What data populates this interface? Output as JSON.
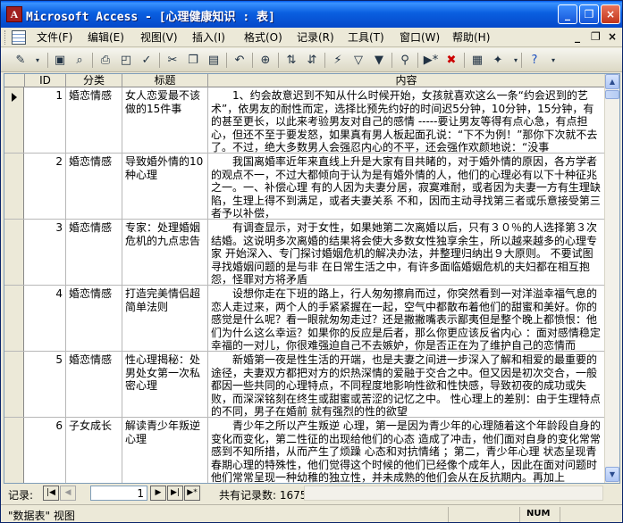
{
  "window": {
    "title": "Microsoft Access - [心理健康知识 : 表]",
    "minimize": "_",
    "restore": "❐",
    "close": "×"
  },
  "menu": {
    "items": [
      "文件(F)",
      "编辑(E)",
      "视图(V)",
      "插入(I)",
      "格式(O)",
      "记录(R)",
      "工具(T)",
      "窗口(W)",
      "帮助(H)"
    ],
    "doc_minimize": "_",
    "doc_restore": "❐",
    "doc_close": "×"
  },
  "toolbar": {
    "icons": [
      "design-view-icon",
      "save-icon",
      "search-database-icon",
      "print-icon",
      "print-preview-icon",
      "spelling-icon",
      "cut-icon",
      "copy-icon",
      "paste-icon",
      "undo-icon",
      "hyperlink-icon",
      "sort-ascending-icon",
      "sort-descending-icon",
      "filter-by-selection-icon",
      "filter-by-form-icon",
      "apply-filter-icon",
      "find-icon",
      "new-record-icon",
      "delete-record-icon",
      "database-window-icon",
      "new-object-icon",
      "help-icon"
    ]
  },
  "table": {
    "columns": [
      "ID",
      "分类",
      "标题",
      "内容"
    ],
    "rows": [
      {
        "id": "1",
        "category": "婚恋情感",
        "title": "女人恋爱最不该做的15件事",
        "content": "1、约会故意迟到不知从什么时候开始，女孩就喜欢这么一条“约会迟到的艺术”，依男友的耐性而定，选择比预先约好的时间迟5分钟，10分钟，15分钟，有的甚至更长，以此来考验男友对自己的感情 -----要让男友等得有点心急，有点担心，但还不至于要发怒，如果真有男人板起面孔说：“下不为例！”那你下次就不去了。不过，绝大多数男人会强忍内心的不平，还会强作欢颜地说：“没事"
      },
      {
        "id": "2",
        "category": "婚恋情感",
        "title": "导致婚外情的10种心理",
        "content": "我国离婚率近年来直线上升是大家有目共睹的，对于婚外情的原因，各方学者的观点不一，不过大都倾向于认为是有婚外情的人，他们的心理必有以下十种征兆之一。一、补偿心理 有的人因为夫妻分居，寂寞难耐，或者因为夫妻一方有生理缺陷，生理上得不到满足，或者夫妻关系 不和，因而主动寻找第三者或乐意接受第三者予以补偿，"
      },
      {
        "id": "3",
        "category": "婚恋情感",
        "title": "专家：处理婚姻危机的九点忠告",
        "content": "有调查显示，对于女性，如果她第二次离婚以后，只有３０％的人选择第３次结婚。这说明多次离婚的结果将会使大多数女性独享余生，所以越来越多的心理专家 开始深入、专门探讨婚姻危机的解决办法，并整理归纳出９大原则。 不要试图寻找婚姻问题的是与非 在日常生活之中，有许多面临婚姻危机的夫妇都在相互抱怨，怪罪对方将矛盾"
      },
      {
        "id": "4",
        "category": "婚恋情感",
        "title": "打造完美情侣超简单法则",
        "content": "设想你走在下班的路上，行人匆匆擦肩而过，你突然看到一对洋溢幸福气息的恋人走过来，两个人的手紧紧握在一起，空气中都散布着他们的甜蜜和美好。你的感觉是什么呢？看一眼就匆匆走过？还是撇撇嘴表示鄙夷但是整个晚上都愤恨：他们为什么这么幸运？如果你的反应是后者，那么你更应该反省内心 ：面对感情稳定幸福的一对儿，你很难强迫自己不去嫉妒，你是否正在为了维护自己的恋情而"
      },
      {
        "id": "5",
        "category": "婚恋情感",
        "title": "性心理揭秘：处男处女第一次私密心理",
        "content": "新婚第一夜是性生活的开端，也是夫妻之间进一步深入了解和相爱的最重要的途径，夫妻双方都把对方的炽热深情的爱融于交合之中。但又因是初次交合，一般都因一些共同的心理特点，不同程度地影响性欲和性快感，导致初夜的成功或失败，而深深铭刻在终生或甜蜜或苦涩的记忆之中。 性心理上的差别：由于生理特点的不同，男子在婚前 就有强烈的性的欲望"
      },
      {
        "id": "6",
        "category": "子女成长",
        "title": "解读青少年叛逆心理",
        "content": "青少年之所以产生叛逆 心理，第一是因为青少年的心理随着这个年龄段自身的变化而变化，第二性征的出现给他们的心态 造成了冲击，他们面对自身的变化常常感到不知所措，从而产生了烦躁 心态和对抗情绪 ；第二，青少年心理 状态呈现青春期心理的特殊性，他们觉得这个时候的他们已经像个成年人，因此在面对问题时他们常常呈现一种幼稚的独立性，并未成熟的他们会从在反抗期内。再加上"
      }
    ]
  },
  "navigator": {
    "label": "记录:",
    "current": "1",
    "total_text": "共有记录数: 16757"
  },
  "status": {
    "view": "\"数据表\" 视图",
    "num": "NUM"
  }
}
